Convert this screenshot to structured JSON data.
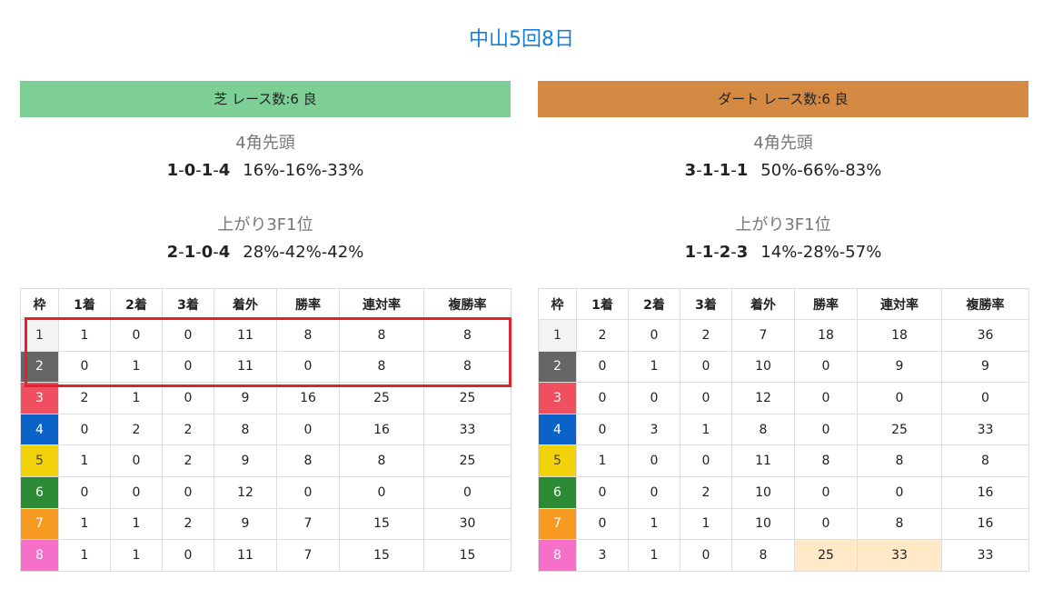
{
  "page_title": "中山5回8日",
  "colors": {
    "title": "#1a7fd4",
    "turf_header": "#7dcf96",
    "dirt_header": "#d48a43",
    "highlight_cell": "#ffe9c7",
    "annotation_box": "#e3212b"
  },
  "frame_colors": [
    {
      "bg": "#f3f3f3",
      "fg": "#333333"
    },
    {
      "bg": "#666666",
      "fg": "#ffffff"
    },
    {
      "bg": "#ef4f5e",
      "fg": "#ffffff"
    },
    {
      "bg": "#0b63c9",
      "fg": "#ffffff"
    },
    {
      "bg": "#f2d20b",
      "fg": "#444444"
    },
    {
      "bg": "#2d8a34",
      "fg": "#ffffff"
    },
    {
      "bg": "#f79a22",
      "fg": "#ffffff"
    },
    {
      "bg": "#f66fc8",
      "fg": "#ffffff"
    }
  ],
  "columns": [
    "枠",
    "1着",
    "2着",
    "3着",
    "着外",
    "勝率",
    "連対率",
    "複勝率"
  ],
  "turf": {
    "header": "芝 レース数:6  良",
    "corner_lead": {
      "label": "4角先頭",
      "r1": "1",
      "r2": "0",
      "r3": "1",
      "r4": "4",
      "pct": "16%-16%-33%"
    },
    "last3f": {
      "label": "上がり3F1位",
      "r1": "2",
      "r2": "1",
      "r3": "0",
      "r4": "4",
      "pct": "28%-42%-42%"
    },
    "rows": [
      [
        "1",
        "1",
        "0",
        "0",
        "11",
        "8",
        "8",
        "8"
      ],
      [
        "2",
        "0",
        "1",
        "0",
        "11",
        "0",
        "8",
        "8"
      ],
      [
        "3",
        "2",
        "1",
        "0",
        "9",
        "16",
        "25",
        "25"
      ],
      [
        "4",
        "0",
        "2",
        "2",
        "8",
        "0",
        "16",
        "33"
      ],
      [
        "5",
        "1",
        "0",
        "2",
        "9",
        "8",
        "8",
        "25"
      ],
      [
        "6",
        "0",
        "0",
        "0",
        "12",
        "0",
        "0",
        "0"
      ],
      [
        "7",
        "1",
        "1",
        "2",
        "9",
        "7",
        "15",
        "30"
      ],
      [
        "8",
        "1",
        "1",
        "0",
        "11",
        "7",
        "15",
        "15"
      ]
    ]
  },
  "dirt": {
    "header": "ダート レース数:6  良",
    "corner_lead": {
      "label": "4角先頭",
      "r1": "3",
      "r2": "1",
      "r3": "1",
      "r4": "1",
      "pct": "50%-66%-83%"
    },
    "last3f": {
      "label": "上がり3F1位",
      "r1": "1",
      "r2": "1",
      "r3": "2",
      "r4": "3",
      "pct": "14%-28%-57%"
    },
    "rows": [
      [
        "1",
        "2",
        "0",
        "2",
        "7",
        "18",
        "18",
        "36"
      ],
      [
        "2",
        "0",
        "1",
        "0",
        "10",
        "0",
        "9",
        "9"
      ],
      [
        "3",
        "0",
        "0",
        "0",
        "12",
        "0",
        "0",
        "0"
      ],
      [
        "4",
        "0",
        "3",
        "1",
        "8",
        "0",
        "25",
        "33"
      ],
      [
        "5",
        "1",
        "0",
        "0",
        "11",
        "8",
        "8",
        "8"
      ],
      [
        "6",
        "0",
        "0",
        "2",
        "10",
        "0",
        "0",
        "16"
      ],
      [
        "7",
        "0",
        "1",
        "1",
        "10",
        "0",
        "8",
        "16"
      ],
      [
        "8",
        "3",
        "1",
        "0",
        "8",
        "25",
        "33",
        "33"
      ]
    ],
    "highlighted_cells": [
      [
        7,
        5
      ],
      [
        7,
        6
      ]
    ]
  }
}
